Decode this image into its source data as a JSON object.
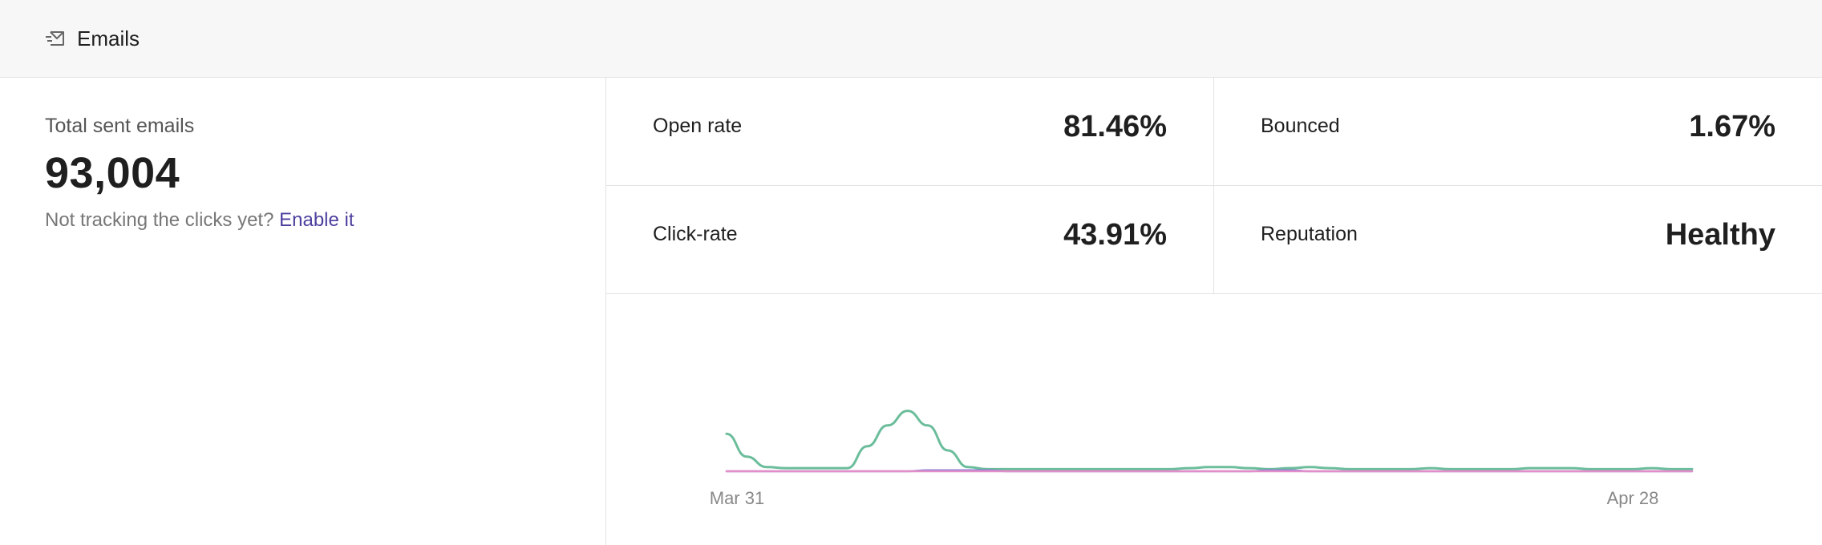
{
  "header": {
    "title": "Emails",
    "icon": "send-mail-icon"
  },
  "summary": {
    "label": "Total sent emails",
    "value": "93,004",
    "hint_text": "Not tracking the clicks yet?",
    "hint_link": "Enable it"
  },
  "metrics": [
    {
      "name": "Open rate",
      "value": "81.46%"
    },
    {
      "name": "Bounced",
      "value": "1.67%"
    },
    {
      "name": "Click-rate",
      "value": "43.91%"
    },
    {
      "name": "Reputation",
      "value": "Healthy"
    }
  ],
  "chart_data": {
    "type": "line",
    "x_tick_labels": [
      "Mar 31",
      "Apr 28"
    ],
    "grid": false,
    "legend": "none",
    "series": [
      {
        "color": "#6bbd9b",
        "values": [
          18,
          7,
          2,
          1.5,
          1.5,
          1.5,
          1.5,
          12,
          22,
          29,
          22,
          10,
          2,
          1,
          1,
          1,
          1,
          1,
          1,
          1,
          1,
          1,
          1,
          1.5,
          2,
          2,
          1.5,
          1,
          1.5,
          2,
          1.5,
          1,
          1,
          1,
          1,
          1.5,
          1,
          1,
          1,
          1,
          1.5,
          1.5,
          1.5,
          1,
          1,
          1,
          1.5,
          1,
          1
        ]
      },
      {
        "color": "#8a7fd8",
        "values": [
          0,
          0,
          0,
          0,
          0,
          0,
          0,
          0,
          0,
          0,
          0.5,
          0.5,
          0.5,
          0.5,
          0,
          0,
          0,
          0,
          0,
          0,
          0,
          0,
          0,
          0,
          0,
          0,
          0,
          0.5,
          0.5,
          0,
          0,
          0,
          0,
          0,
          0,
          0,
          0,
          0,
          0,
          0,
          0,
          0,
          0,
          0,
          0,
          0,
          0,
          0,
          0
        ]
      },
      {
        "color": "#e38ec8",
        "values": [
          0,
          0,
          0,
          0,
          0,
          0,
          0,
          0,
          0,
          0,
          0,
          0,
          0,
          0,
          0,
          0,
          0,
          0,
          0,
          0,
          0,
          0,
          0,
          0,
          0,
          0,
          0,
          0,
          0,
          0,
          0,
          0,
          0,
          0,
          0,
          0,
          0,
          0,
          0,
          0,
          0,
          0,
          0,
          0,
          0,
          0,
          0,
          0,
          0
        ]
      }
    ]
  }
}
